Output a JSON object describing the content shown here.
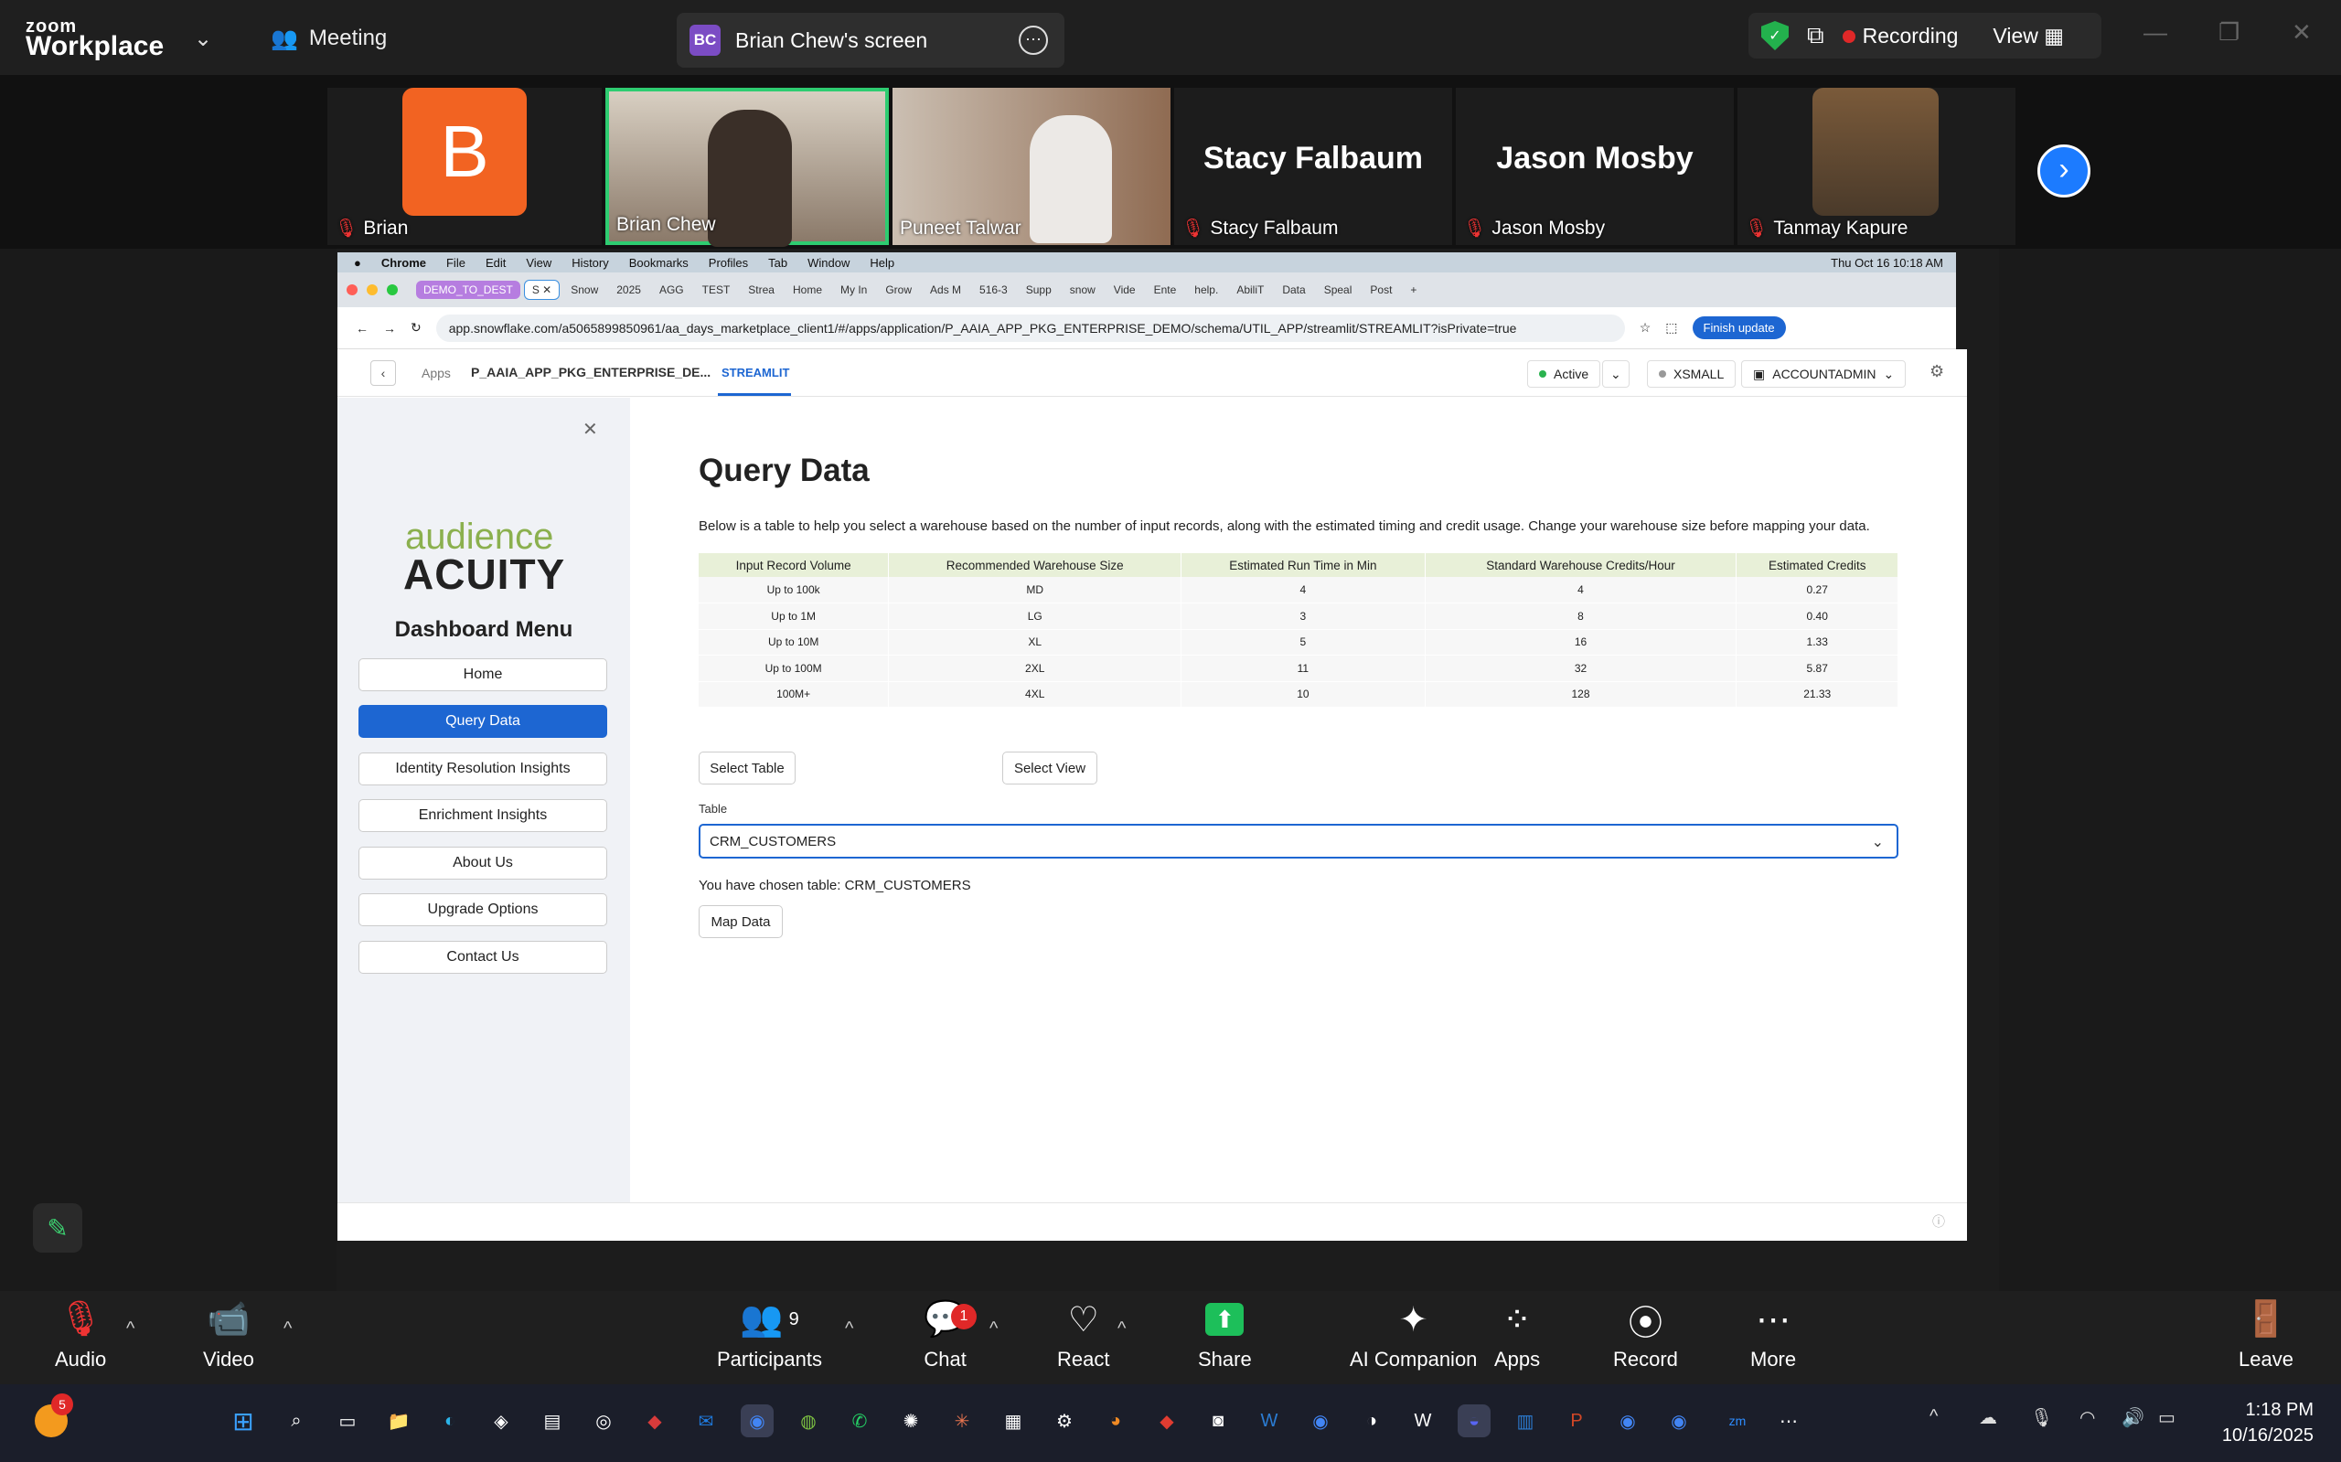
{
  "zoom": {
    "logo_top": "zoom",
    "logo_bottom": "Workplace",
    "meeting_label": "Meeting",
    "screen_tab_initials": "BC",
    "screen_tab_label": "Brian Chew's screen",
    "recording_label": "Recording",
    "view_label": "View"
  },
  "participants_strip": [
    {
      "name": "Brian",
      "avatar_letter": "B",
      "avatar_color": "#f26322"
    },
    {
      "name": "Brian Chew"
    },
    {
      "name": "Puneet Talwar"
    },
    {
      "name": "Stacy Falbaum",
      "big_name": "Stacy Falbaum"
    },
    {
      "name": "Jason Mosby",
      "big_name": "Jason Mosby"
    },
    {
      "name": "Tanmay Kapure"
    }
  ],
  "mac_menu": [
    "Chrome",
    "File",
    "Edit",
    "View",
    "History",
    "Bookmarks",
    "Profiles",
    "Tab",
    "Window",
    "Help"
  ],
  "mac_clock": "Thu Oct 16  10:18 AM",
  "chrome_tabs": [
    "DEMO_TO_DEST",
    "S",
    "Snow",
    "2025",
    "AGG",
    "TEST",
    "Strea",
    "Home",
    "My In",
    "Grow",
    "Ads M",
    "516-3",
    "Supp",
    "snow",
    "Vide",
    "Ente",
    "help.",
    "AbiliT",
    "Data",
    "Speal",
    "Post"
  ],
  "address": {
    "url": "app.snowflake.com/a5065899850961/aa_days_marketplace_client1/#/apps/application/P_AAIA_APP_PKG_ENTERPRISE_DEMO/schema/UTIL_APP/streamlit/STREAMLIT?isPrivate=true",
    "finish_update": "Finish update"
  },
  "app_header": {
    "apps": "Apps",
    "package": "P_AAIA_APP_PKG_ENTERPRISE_DE...",
    "streamlit": "STREAMLIT",
    "active": "Active",
    "warehouse": "XSMALL",
    "role": "ACCOUNTADMIN"
  },
  "sidebar": {
    "logo_line1": "audience",
    "logo_line2": "ACUITY",
    "title": "Dashboard Menu",
    "items": [
      "Home",
      "Query Data",
      "Identity Resolution Insights",
      "Enrichment Insights",
      "About Us",
      "Upgrade Options",
      "Contact Us"
    ]
  },
  "main": {
    "title": "Query Data",
    "description": "Below is a table to help you select a warehouse based on the number of input records, along with the estimated timing and credit usage. Change your warehouse size before mapping your data.",
    "table_headers": [
      "Input Record Volume",
      "Recommended Warehouse Size",
      "Estimated Run Time in Min",
      "Standard Warehouse Credits/Hour",
      "Estimated Credits"
    ],
    "table_rows": [
      [
        "Up to 100k",
        "MD",
        "4",
        "4",
        "0.27"
      ],
      [
        "Up to 1M",
        "LG",
        "3",
        "8",
        "0.40"
      ],
      [
        "Up to 10M",
        "XL",
        "5",
        "16",
        "1.33"
      ],
      [
        "Up to 100M",
        "2XL",
        "11",
        "32",
        "5.87"
      ],
      [
        "100M+",
        "4XL",
        "10",
        "128",
        "21.33"
      ]
    ],
    "select_table_btn": "Select Table",
    "select_view_btn": "Select View",
    "table_label": "Table",
    "table_value": "CRM_CUSTOMERS",
    "chosen_text": "You have chosen table: CRM_CUSTOMERS",
    "map_data_btn": "Map Data"
  },
  "zoom_controls": {
    "audio": "Audio",
    "video": "Video",
    "participants": "Participants",
    "participants_count": "9",
    "chat": "Chat",
    "chat_badge": "1",
    "react": "React",
    "share": "Share",
    "ai_companion": "AI Companion",
    "apps": "Apps",
    "record": "Record",
    "more": "More",
    "leave": "Leave"
  },
  "taskbar": {
    "notif_badge": "5",
    "time": "1:18 PM",
    "date": "10/16/2025"
  }
}
